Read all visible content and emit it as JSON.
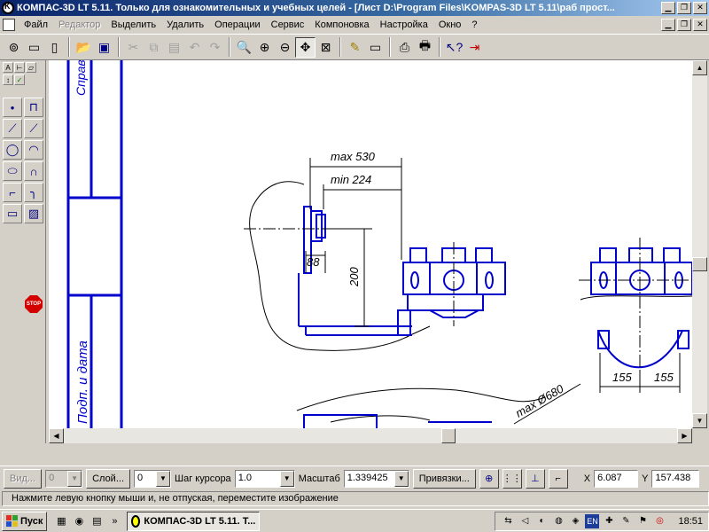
{
  "window": {
    "title": "КОМПАС-3D LT 5.11. Только для ознакомительных и учебных целей - [Лист D:\\Program Files\\KOMPAS-3D LT 5.11\\раб прост..."
  },
  "menu": {
    "items": [
      "Файл",
      "Редактор",
      "Выделить",
      "Удалить",
      "Операции",
      "Сервис",
      "Компоновка",
      "Настройка",
      "Окно",
      "?"
    ],
    "disabled_index": 1
  },
  "toolbar": {
    "icons": [
      "new-view-icon",
      "new-document-icon",
      "new-sheet-icon",
      "open-icon",
      "save-icon",
      "cut-icon",
      "copy-icon",
      "paste-icon",
      "undo-icon",
      "redo-icon",
      "zoom-icon",
      "zoom-in-icon",
      "zoom-out-icon",
      "pan-icon",
      "zoom-fit-icon",
      "edit-icon",
      "sheet-icon",
      "print-preview-icon",
      "print-icon",
      "help-pointer-icon",
      "exit-icon"
    ]
  },
  "drawing": {
    "title_block_top": "Справ",
    "title_block_bottom": "Подп. и дата",
    "dim_max": "max 530",
    "dim_min": "min 224",
    "dim_88": "88",
    "dim_200": "200",
    "dim_155a": "155",
    "dim_155b": "155",
    "dim_diam": "max Ø680"
  },
  "propbar": {
    "view_label": "Вид...",
    "view_value": "0",
    "layer_label": "Слой...",
    "layer_value": "0",
    "cursor_step_label": "Шаг курсора",
    "cursor_step_value": "1.0",
    "scale_label": "Масштаб",
    "scale_value": "1.339425",
    "snap_label": "Привязки...",
    "x_label": "X",
    "x_value": "6.087",
    "y_label": "Y",
    "y_value": "157.438"
  },
  "status": {
    "text": "Нажмите левую кнопку мыши и, не отпуская, переместите изображение"
  },
  "taskbar": {
    "start_label": "Пуск",
    "task_label": "КОМПАС-3D LT 5.11. Т...",
    "lang": "EN",
    "clock": "18:51"
  },
  "colors": {
    "titlebar": "#0a246a",
    "drawing_line": "#0000cc",
    "face": "#d4d0c8"
  }
}
